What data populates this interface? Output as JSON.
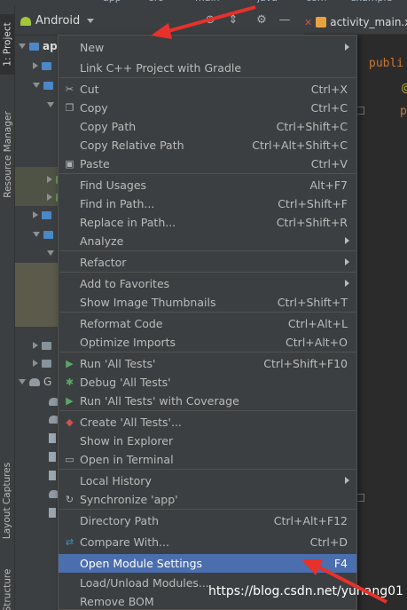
{
  "breadcrumbs": [
    "",
    "app",
    "src",
    "main",
    "java",
    "com",
    "example"
  ],
  "tool_stripe": {
    "project_tab": "1: Project",
    "resource_tab": "Resource Manager",
    "captures_tab": "Layout Captures",
    "structure_tab": "Structure"
  },
  "project_panel": {
    "view_mode": "Android",
    "root_label": "ap",
    "gradle_label": "G"
  },
  "editor": {
    "tab_name": "activity_main.xml",
    "code_line1": "publi",
    "code_line2": "@",
    "code_line3": "p"
  },
  "context_menu": {
    "items": [
      {
        "label": "New",
        "shortcut": "",
        "submenu": true,
        "icon": ""
      },
      {
        "label": "Link C++ Project with Gradle",
        "shortcut": "",
        "submenu": false,
        "icon": ""
      },
      {
        "label": "Cut",
        "shortcut": "Ctrl+X",
        "submenu": false,
        "icon": "scissors-icon"
      },
      {
        "label": "Copy",
        "shortcut": "Ctrl+C",
        "submenu": false,
        "icon": "copy-icon"
      },
      {
        "label": "Copy Path",
        "shortcut": "Ctrl+Shift+C",
        "submenu": false,
        "icon": ""
      },
      {
        "label": "Copy Relative Path",
        "shortcut": "Ctrl+Alt+Shift+C",
        "submenu": false,
        "icon": ""
      },
      {
        "label": "Paste",
        "shortcut": "Ctrl+V",
        "submenu": false,
        "icon": "paste-icon"
      },
      {
        "label": "Find Usages",
        "shortcut": "Alt+F7",
        "submenu": false,
        "icon": ""
      },
      {
        "label": "Find in Path...",
        "shortcut": "Ctrl+Shift+F",
        "submenu": false,
        "icon": ""
      },
      {
        "label": "Replace in Path...",
        "shortcut": "Ctrl+Shift+R",
        "submenu": false,
        "icon": ""
      },
      {
        "label": "Analyze",
        "shortcut": "",
        "submenu": true,
        "icon": ""
      },
      {
        "label": "Refactor",
        "shortcut": "",
        "submenu": true,
        "icon": ""
      },
      {
        "label": "Add to Favorites",
        "shortcut": "",
        "submenu": true,
        "icon": ""
      },
      {
        "label": "Show Image Thumbnails",
        "shortcut": "Ctrl+Shift+T",
        "submenu": false,
        "icon": ""
      },
      {
        "label": "Reformat Code",
        "shortcut": "Ctrl+Alt+L",
        "submenu": false,
        "icon": ""
      },
      {
        "label": "Optimize Imports",
        "shortcut": "Ctrl+Alt+O",
        "submenu": false,
        "icon": ""
      },
      {
        "label": "Run 'All Tests'",
        "shortcut": "Ctrl+Shift+F10",
        "submenu": false,
        "icon": "run-icon"
      },
      {
        "label": "Debug 'All Tests'",
        "shortcut": "",
        "submenu": false,
        "icon": "debug-icon"
      },
      {
        "label": "Run 'All Tests' with Coverage",
        "shortcut": "",
        "submenu": false,
        "icon": "coverage-icon"
      },
      {
        "label": "Create 'All Tests'...",
        "shortcut": "",
        "submenu": false,
        "icon": "create-config-icon"
      },
      {
        "label": "Show in Explorer",
        "shortcut": "",
        "submenu": false,
        "icon": ""
      },
      {
        "label": "Open in Terminal",
        "shortcut": "",
        "submenu": false,
        "icon": "terminal-icon"
      },
      {
        "label": "Local History",
        "shortcut": "",
        "submenu": true,
        "icon": ""
      },
      {
        "label": "Synchronize 'app'",
        "shortcut": "",
        "submenu": false,
        "icon": "sync-icon"
      },
      {
        "label": "Directory Path",
        "shortcut": "Ctrl+Alt+F12",
        "submenu": false,
        "icon": ""
      },
      {
        "label": "Compare With...",
        "shortcut": "Ctrl+D",
        "submenu": false,
        "icon": "compare-icon"
      },
      {
        "label": "Open Module Settings",
        "shortcut": "F4",
        "submenu": false,
        "icon": "",
        "selected": true
      },
      {
        "label": "Load/Unload Modules...",
        "shortcut": "",
        "submenu": false,
        "icon": ""
      },
      {
        "label": "Remove BOM",
        "shortcut": "",
        "submenu": false,
        "icon": ""
      }
    ]
  },
  "watermark": "https://blog.csdn.net/yuhang01",
  "colors": {
    "selection": "#4b6eaf",
    "annotation_arrow": "#e8312a",
    "menu_bg": "#3c3f41",
    "editor_bg": "#2b2b2b"
  }
}
